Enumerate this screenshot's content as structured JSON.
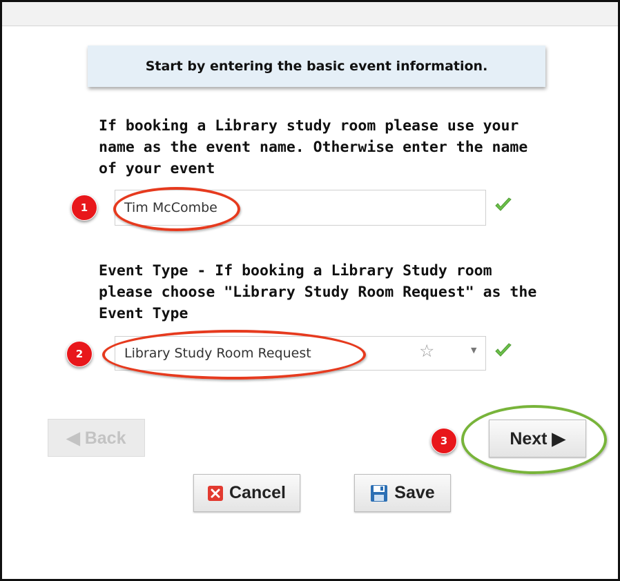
{
  "banner": {
    "text": "Start by entering the basic event information."
  },
  "event_name": {
    "label": "If booking a Library study room please use your name as the event name. Otherwise enter the name of your event",
    "value": "Tim McCombe",
    "annotation_number": "1"
  },
  "event_type": {
    "label": "Event Type - If booking a Library Study room please choose \"Library Study Room Request\" as the Event Type",
    "value": "Library Study Room Request",
    "annotation_number": "2"
  },
  "navigation": {
    "back_label": "◀ Back",
    "next_label": "Next ▶",
    "next_annotation_number": "3"
  },
  "actions": {
    "cancel_label": "Cancel",
    "save_label": "Save"
  },
  "colors": {
    "banner_bg": "#e5eff7",
    "badge": "#e8171b",
    "ring_red": "#e63a1e",
    "ring_green": "#78b43a",
    "check_green": "#5cb85c"
  },
  "icons": [
    "checkmark-icon",
    "star-icon",
    "dropdown-caret-icon",
    "cancel-icon",
    "save-disk-icon"
  ]
}
